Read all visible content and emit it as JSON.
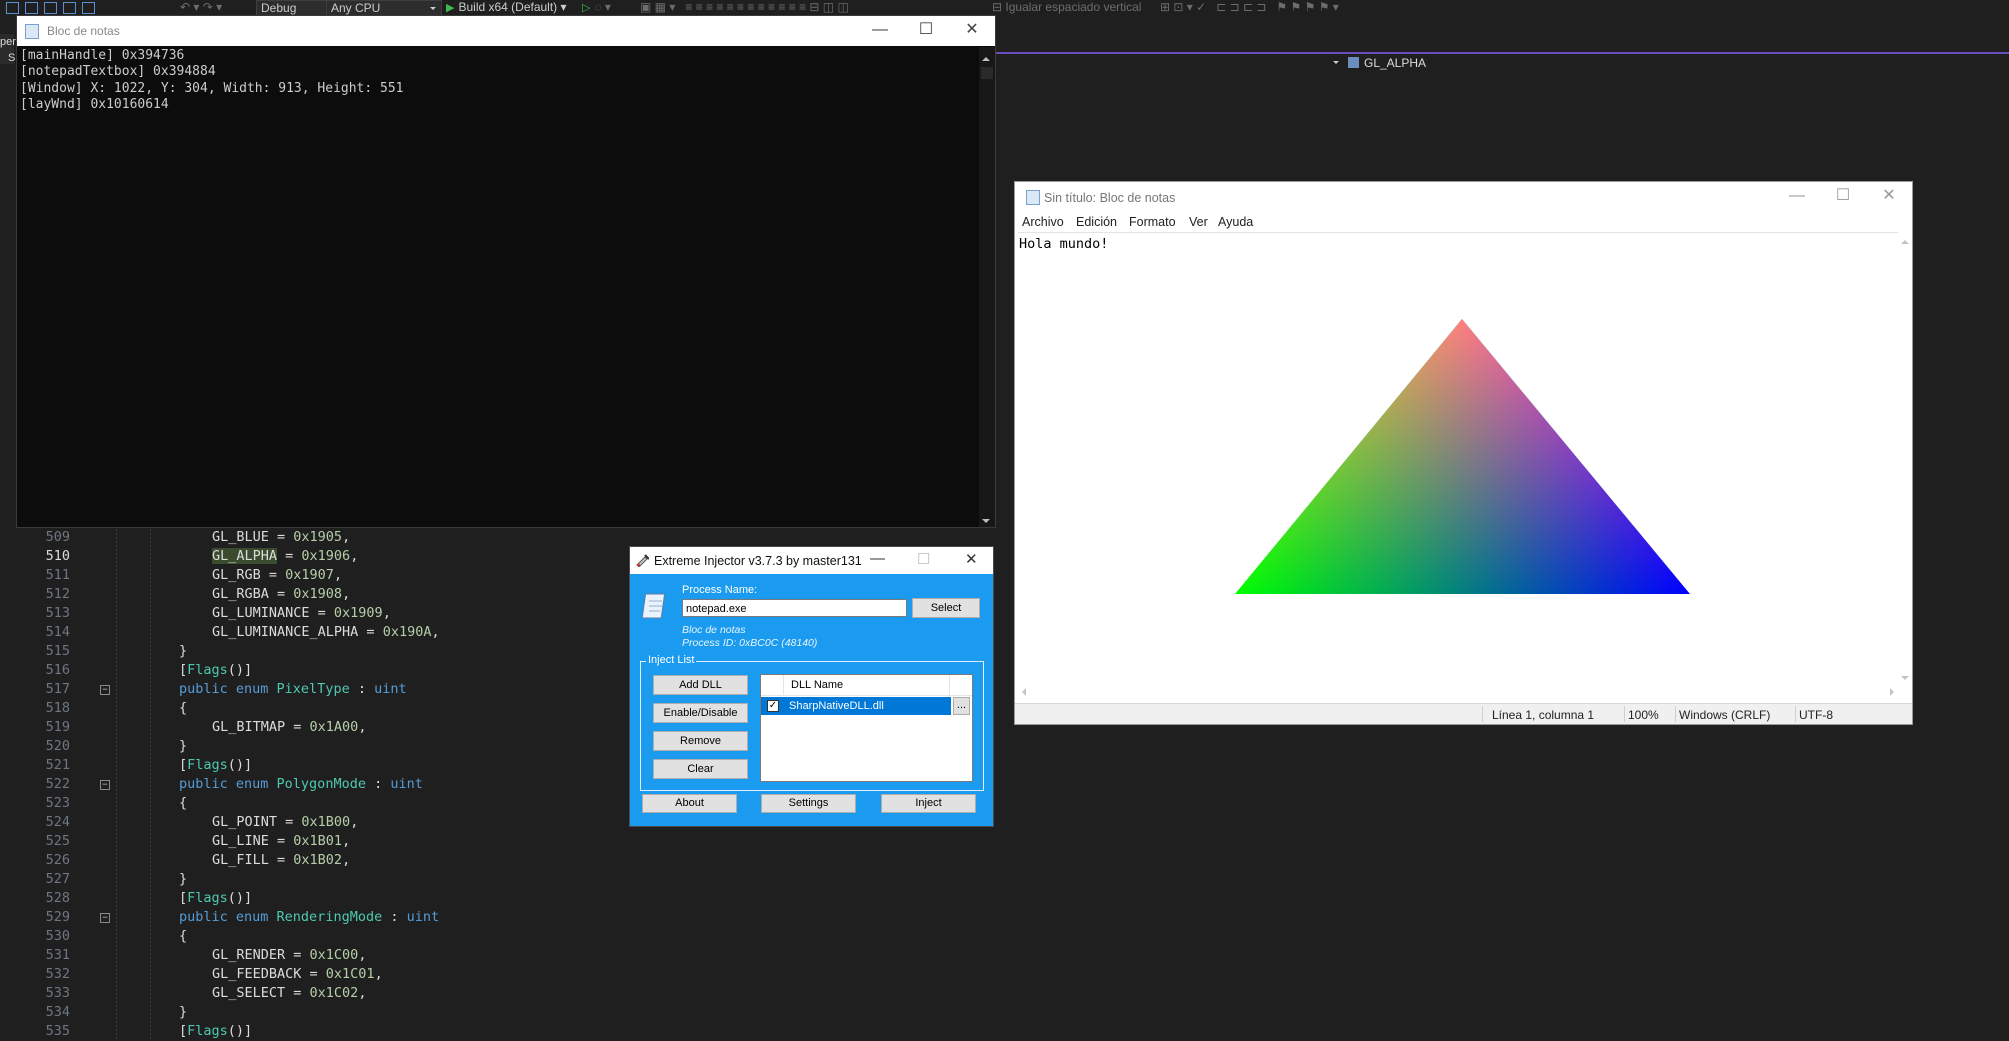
{
  "vs": {
    "toolbar": {
      "config": "Debug",
      "platform": "Any CPU",
      "build_target": "Build x64 (Default)",
      "equal_vertical_spacing": "Igualar espaciado vertical"
    },
    "edge_text": "per",
    "edge_text2": "Sl",
    "nav_member": "GL_ALPHA"
  },
  "editor": {
    "current_line": 510,
    "lines": [
      {
        "n": "509",
        "c": "GL_BLUE = 0x1905,"
      },
      {
        "n": "510",
        "c": "GL_ALPHA = 0x1906,"
      },
      {
        "n": "511",
        "c": "GL_RGB = 0x1907,"
      },
      {
        "n": "512",
        "c": "GL_RGBA = 0x1908,"
      },
      {
        "n": "513",
        "c": "GL_LUMINANCE = 0x1909,"
      },
      {
        "n": "514",
        "c": "GL_LUMINANCE_ALPHA = 0x190A,"
      },
      {
        "n": "515",
        "c": "}"
      },
      {
        "n": "516",
        "c": "[Flags()]"
      },
      {
        "n": "517",
        "c": "public enum PixelType : uint"
      },
      {
        "n": "518",
        "c": "{"
      },
      {
        "n": "519",
        "c": "GL_BITMAP = 0x1A00,"
      },
      {
        "n": "520",
        "c": "}"
      },
      {
        "n": "521",
        "c": "[Flags()]"
      },
      {
        "n": "522",
        "c": "public enum PolygonMode : uint"
      },
      {
        "n": "523",
        "c": "{"
      },
      {
        "n": "524",
        "c": "GL_POINT = 0x1B00,"
      },
      {
        "n": "525",
        "c": "GL_LINE = 0x1B01,"
      },
      {
        "n": "526",
        "c": "GL_FILL = 0x1B02,"
      },
      {
        "n": "527",
        "c": "}"
      },
      {
        "n": "528",
        "c": "[Flags()]"
      },
      {
        "n": "529",
        "c": "public enum RenderingMode : uint"
      },
      {
        "n": "530",
        "c": "{"
      },
      {
        "n": "531",
        "c": "GL_RENDER = 0x1C00,"
      },
      {
        "n": "532",
        "c": "GL_FEEDBACK = 0x1C01,"
      },
      {
        "n": "533",
        "c": "GL_SELECT = 0x1C02,"
      },
      {
        "n": "534",
        "c": "}"
      },
      {
        "n": "535",
        "c": "[Flags()]"
      }
    ]
  },
  "console": {
    "title": "Bloc de notas",
    "lines": [
      "[mainHandle] 0x394736",
      "[notepadTextbox] 0x394884",
      "[Window] X: 1022, Y: 304, Width: 913, Height: 551",
      "[layWnd] 0x10160614"
    ]
  },
  "notepad": {
    "title": "Sin título: Bloc de notas",
    "menu": [
      "Archivo",
      "Edición",
      "Formato",
      "Ver",
      "Ayuda"
    ],
    "text": "Hola mundo!",
    "status": {
      "position": "Línea 1, columna 1",
      "zoom": "100%",
      "line_ending": "Windows (CRLF)",
      "encoding": "UTF-8"
    },
    "triangle_colors": {
      "top": "#ff0000",
      "left": "#00ff00",
      "right": "#0000ff"
    }
  },
  "injector": {
    "title": "Extreme Injector v3.7.3 by master131",
    "process_label": "Process Name:",
    "process_value": "notepad.exe",
    "select_button": "Select",
    "process_desc": "Bloc de notas",
    "process_id": "Process ID: 0xBC0C (48140)",
    "inject_list_label": "Inject List",
    "buttons": {
      "add_dll": "Add DLL",
      "enable_disable": "Enable/Disable",
      "remove": "Remove",
      "clear": "Clear",
      "about": "About",
      "settings": "Settings",
      "inject": "Inject"
    },
    "dll_header": "DLL Name",
    "dll_items": [
      {
        "name": "SharpNativeDLL.dll",
        "checked": true
      }
    ],
    "ellipsis": "...",
    "accent": "#1a9bef"
  }
}
